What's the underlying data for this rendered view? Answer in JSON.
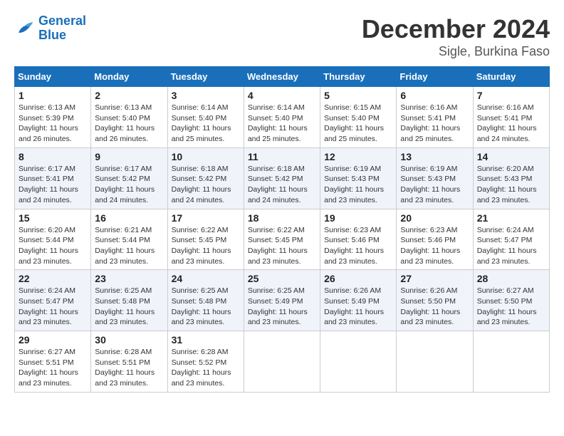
{
  "logo": {
    "line1": "General",
    "line2": "Blue"
  },
  "title": {
    "month": "December 2024",
    "location": "Sigle, Burkina Faso"
  },
  "weekdays": [
    "Sunday",
    "Monday",
    "Tuesday",
    "Wednesday",
    "Thursday",
    "Friday",
    "Saturday"
  ],
  "weeks": [
    [
      {
        "day": "1",
        "sunrise": "6:13 AM",
        "sunset": "5:39 PM",
        "daylight": "11 hours and 26 minutes."
      },
      {
        "day": "2",
        "sunrise": "6:13 AM",
        "sunset": "5:40 PM",
        "daylight": "11 hours and 26 minutes."
      },
      {
        "day": "3",
        "sunrise": "6:14 AM",
        "sunset": "5:40 PM",
        "daylight": "11 hours and 25 minutes."
      },
      {
        "day": "4",
        "sunrise": "6:14 AM",
        "sunset": "5:40 PM",
        "daylight": "11 hours and 25 minutes."
      },
      {
        "day": "5",
        "sunrise": "6:15 AM",
        "sunset": "5:40 PM",
        "daylight": "11 hours and 25 minutes."
      },
      {
        "day": "6",
        "sunrise": "6:16 AM",
        "sunset": "5:41 PM",
        "daylight": "11 hours and 25 minutes."
      },
      {
        "day": "7",
        "sunrise": "6:16 AM",
        "sunset": "5:41 PM",
        "daylight": "11 hours and 24 minutes."
      }
    ],
    [
      {
        "day": "8",
        "sunrise": "6:17 AM",
        "sunset": "5:41 PM",
        "daylight": "11 hours and 24 minutes."
      },
      {
        "day": "9",
        "sunrise": "6:17 AM",
        "sunset": "5:42 PM",
        "daylight": "11 hours and 24 minutes."
      },
      {
        "day": "10",
        "sunrise": "6:18 AM",
        "sunset": "5:42 PM",
        "daylight": "11 hours and 24 minutes."
      },
      {
        "day": "11",
        "sunrise": "6:18 AM",
        "sunset": "5:42 PM",
        "daylight": "11 hours and 24 minutes."
      },
      {
        "day": "12",
        "sunrise": "6:19 AM",
        "sunset": "5:43 PM",
        "daylight": "11 hours and 23 minutes."
      },
      {
        "day": "13",
        "sunrise": "6:19 AM",
        "sunset": "5:43 PM",
        "daylight": "11 hours and 23 minutes."
      },
      {
        "day": "14",
        "sunrise": "6:20 AM",
        "sunset": "5:43 PM",
        "daylight": "11 hours and 23 minutes."
      }
    ],
    [
      {
        "day": "15",
        "sunrise": "6:20 AM",
        "sunset": "5:44 PM",
        "daylight": "11 hours and 23 minutes."
      },
      {
        "day": "16",
        "sunrise": "6:21 AM",
        "sunset": "5:44 PM",
        "daylight": "11 hours and 23 minutes."
      },
      {
        "day": "17",
        "sunrise": "6:22 AM",
        "sunset": "5:45 PM",
        "daylight": "11 hours and 23 minutes."
      },
      {
        "day": "18",
        "sunrise": "6:22 AM",
        "sunset": "5:45 PM",
        "daylight": "11 hours and 23 minutes."
      },
      {
        "day": "19",
        "sunrise": "6:23 AM",
        "sunset": "5:46 PM",
        "daylight": "11 hours and 23 minutes."
      },
      {
        "day": "20",
        "sunrise": "6:23 AM",
        "sunset": "5:46 PM",
        "daylight": "11 hours and 23 minutes."
      },
      {
        "day": "21",
        "sunrise": "6:24 AM",
        "sunset": "5:47 PM",
        "daylight": "11 hours and 23 minutes."
      }
    ],
    [
      {
        "day": "22",
        "sunrise": "6:24 AM",
        "sunset": "5:47 PM",
        "daylight": "11 hours and 23 minutes."
      },
      {
        "day": "23",
        "sunrise": "6:25 AM",
        "sunset": "5:48 PM",
        "daylight": "11 hours and 23 minutes."
      },
      {
        "day": "24",
        "sunrise": "6:25 AM",
        "sunset": "5:48 PM",
        "daylight": "11 hours and 23 minutes."
      },
      {
        "day": "25",
        "sunrise": "6:25 AM",
        "sunset": "5:49 PM",
        "daylight": "11 hours and 23 minutes."
      },
      {
        "day": "26",
        "sunrise": "6:26 AM",
        "sunset": "5:49 PM",
        "daylight": "11 hours and 23 minutes."
      },
      {
        "day": "27",
        "sunrise": "6:26 AM",
        "sunset": "5:50 PM",
        "daylight": "11 hours and 23 minutes."
      },
      {
        "day": "28",
        "sunrise": "6:27 AM",
        "sunset": "5:50 PM",
        "daylight": "11 hours and 23 minutes."
      }
    ],
    [
      {
        "day": "29",
        "sunrise": "6:27 AM",
        "sunset": "5:51 PM",
        "daylight": "11 hours and 23 minutes."
      },
      {
        "day": "30",
        "sunrise": "6:28 AM",
        "sunset": "5:51 PM",
        "daylight": "11 hours and 23 minutes."
      },
      {
        "day": "31",
        "sunrise": "6:28 AM",
        "sunset": "5:52 PM",
        "daylight": "11 hours and 23 minutes."
      },
      null,
      null,
      null,
      null
    ]
  ]
}
